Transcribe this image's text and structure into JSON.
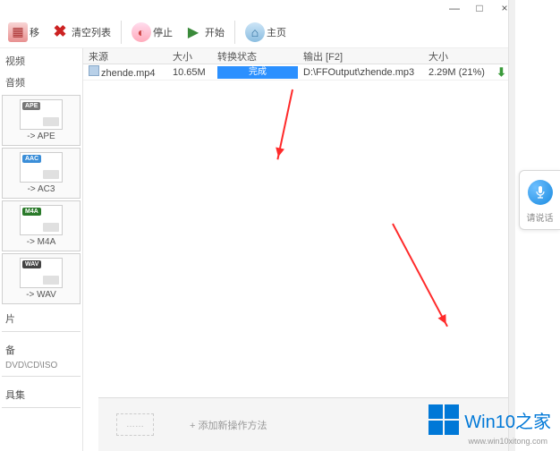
{
  "window": {
    "min": "—",
    "max": "□",
    "close": "×"
  },
  "toolbar": {
    "remove": "移",
    "clear": "清空列表",
    "stop": "停止",
    "start": "开始",
    "home": "主页"
  },
  "sidebar": {
    "top_label": "视频",
    "section2": "音频",
    "formats": [
      {
        "name": "-> APE",
        "badge": "APE"
      },
      {
        "name": "-> AC3",
        "badge": "AAC"
      },
      {
        "name": "-> M4A",
        "badge": "M4A"
      },
      {
        "name": "-> WAV",
        "badge": "WAV"
      }
    ],
    "sec_pic": "片",
    "sec_dev": "备",
    "sub_dev": "DVD\\CD\\ISO",
    "sec_tool": "具集"
  },
  "columns": {
    "src": "来源",
    "size": "大小",
    "status": "转换状态",
    "out": "输出 [F2]",
    "osize": "大小"
  },
  "rows": [
    {
      "filename": "zhende.mp4",
      "size": "10.65M",
      "status": "完成",
      "output": "D:\\FFOutput\\zhende.mp3",
      "osize": "2.29M (21%)"
    }
  ],
  "bottom": {
    "box": "……",
    "add": "+  添加新操作方法"
  },
  "float": {
    "label": "请说话"
  },
  "watermark": {
    "text": "Win10之家",
    "url": "www.win10xitong.com"
  }
}
